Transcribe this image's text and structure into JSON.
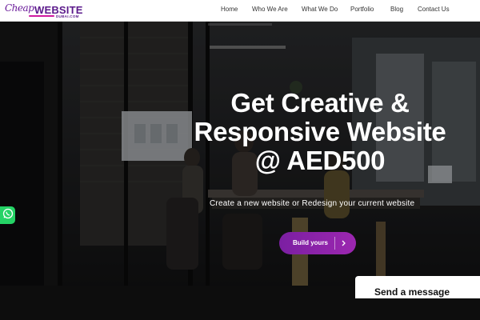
{
  "logo": {
    "script_text": "Cheap",
    "brand_text": "WEBSITE",
    "sub_text": "DUBAI.COM"
  },
  "nav": {
    "items": [
      "Home",
      "Who We Are",
      "What We Do",
      "Portfolio",
      "Blog",
      "Contact Us"
    ]
  },
  "hero": {
    "title_line1": "Get Creative &",
    "title_line2": "Responsive Website",
    "title_line3": "@ AED500",
    "subtitle": "Create a new website or Redesign your current website",
    "cta_label": "Build yours",
    "cta_icon": "chevron-right-icon"
  },
  "widgets": {
    "whatsapp_icon": "whatsapp-icon",
    "send_message_label": "Send a message"
  },
  "colors": {
    "brand_purple": "#5b1a8b",
    "cta_gradient_start": "#7b1fa2",
    "cta_gradient_end": "#9c27b0",
    "whatsapp_green": "#25d366"
  }
}
